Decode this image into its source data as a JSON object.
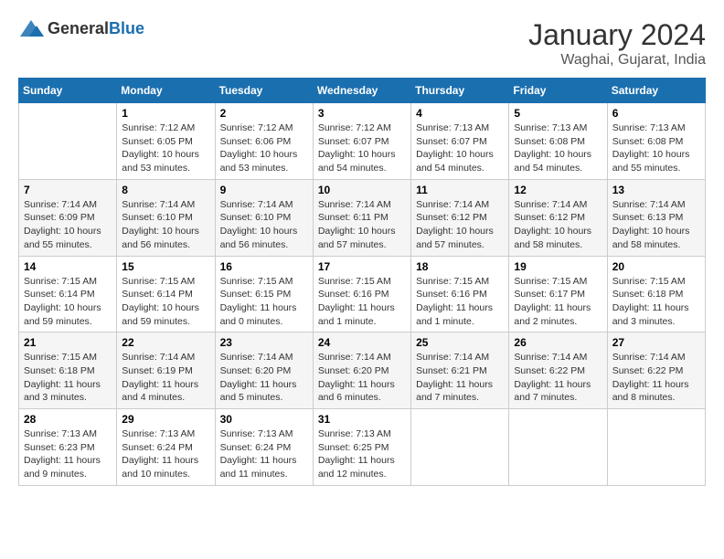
{
  "header": {
    "logo": {
      "general": "General",
      "blue": "Blue"
    },
    "title": "January 2024",
    "location": "Waghai, Gujarat, India"
  },
  "calendar": {
    "weekdays": [
      "Sunday",
      "Monday",
      "Tuesday",
      "Wednesday",
      "Thursday",
      "Friday",
      "Saturday"
    ],
    "weeks": [
      [
        {
          "day": "",
          "info": ""
        },
        {
          "day": "1",
          "info": "Sunrise: 7:12 AM\nSunset: 6:05 PM\nDaylight: 10 hours\nand 53 minutes."
        },
        {
          "day": "2",
          "info": "Sunrise: 7:12 AM\nSunset: 6:06 PM\nDaylight: 10 hours\nand 53 minutes."
        },
        {
          "day": "3",
          "info": "Sunrise: 7:12 AM\nSunset: 6:07 PM\nDaylight: 10 hours\nand 54 minutes."
        },
        {
          "day": "4",
          "info": "Sunrise: 7:13 AM\nSunset: 6:07 PM\nDaylight: 10 hours\nand 54 minutes."
        },
        {
          "day": "5",
          "info": "Sunrise: 7:13 AM\nSunset: 6:08 PM\nDaylight: 10 hours\nand 54 minutes."
        },
        {
          "day": "6",
          "info": "Sunrise: 7:13 AM\nSunset: 6:08 PM\nDaylight: 10 hours\nand 55 minutes."
        }
      ],
      [
        {
          "day": "7",
          "info": "Sunrise: 7:14 AM\nSunset: 6:09 PM\nDaylight: 10 hours\nand 55 minutes."
        },
        {
          "day": "8",
          "info": "Sunrise: 7:14 AM\nSunset: 6:10 PM\nDaylight: 10 hours\nand 56 minutes."
        },
        {
          "day": "9",
          "info": "Sunrise: 7:14 AM\nSunset: 6:10 PM\nDaylight: 10 hours\nand 56 minutes."
        },
        {
          "day": "10",
          "info": "Sunrise: 7:14 AM\nSunset: 6:11 PM\nDaylight: 10 hours\nand 57 minutes."
        },
        {
          "day": "11",
          "info": "Sunrise: 7:14 AM\nSunset: 6:12 PM\nDaylight: 10 hours\nand 57 minutes."
        },
        {
          "day": "12",
          "info": "Sunrise: 7:14 AM\nSunset: 6:12 PM\nDaylight: 10 hours\nand 58 minutes."
        },
        {
          "day": "13",
          "info": "Sunrise: 7:14 AM\nSunset: 6:13 PM\nDaylight: 10 hours\nand 58 minutes."
        }
      ],
      [
        {
          "day": "14",
          "info": "Sunrise: 7:15 AM\nSunset: 6:14 PM\nDaylight: 10 hours\nand 59 minutes."
        },
        {
          "day": "15",
          "info": "Sunrise: 7:15 AM\nSunset: 6:14 PM\nDaylight: 10 hours\nand 59 minutes."
        },
        {
          "day": "16",
          "info": "Sunrise: 7:15 AM\nSunset: 6:15 PM\nDaylight: 11 hours\nand 0 minutes."
        },
        {
          "day": "17",
          "info": "Sunrise: 7:15 AM\nSunset: 6:16 PM\nDaylight: 11 hours\nand 1 minute."
        },
        {
          "day": "18",
          "info": "Sunrise: 7:15 AM\nSunset: 6:16 PM\nDaylight: 11 hours\nand 1 minute."
        },
        {
          "day": "19",
          "info": "Sunrise: 7:15 AM\nSunset: 6:17 PM\nDaylight: 11 hours\nand 2 minutes."
        },
        {
          "day": "20",
          "info": "Sunrise: 7:15 AM\nSunset: 6:18 PM\nDaylight: 11 hours\nand 3 minutes."
        }
      ],
      [
        {
          "day": "21",
          "info": "Sunrise: 7:15 AM\nSunset: 6:18 PM\nDaylight: 11 hours\nand 3 minutes."
        },
        {
          "day": "22",
          "info": "Sunrise: 7:14 AM\nSunset: 6:19 PM\nDaylight: 11 hours\nand 4 minutes."
        },
        {
          "day": "23",
          "info": "Sunrise: 7:14 AM\nSunset: 6:20 PM\nDaylight: 11 hours\nand 5 minutes."
        },
        {
          "day": "24",
          "info": "Sunrise: 7:14 AM\nSunset: 6:20 PM\nDaylight: 11 hours\nand 6 minutes."
        },
        {
          "day": "25",
          "info": "Sunrise: 7:14 AM\nSunset: 6:21 PM\nDaylight: 11 hours\nand 7 minutes."
        },
        {
          "day": "26",
          "info": "Sunrise: 7:14 AM\nSunset: 6:22 PM\nDaylight: 11 hours\nand 7 minutes."
        },
        {
          "day": "27",
          "info": "Sunrise: 7:14 AM\nSunset: 6:22 PM\nDaylight: 11 hours\nand 8 minutes."
        }
      ],
      [
        {
          "day": "28",
          "info": "Sunrise: 7:13 AM\nSunset: 6:23 PM\nDaylight: 11 hours\nand 9 minutes."
        },
        {
          "day": "29",
          "info": "Sunrise: 7:13 AM\nSunset: 6:24 PM\nDaylight: 11 hours\nand 10 minutes."
        },
        {
          "day": "30",
          "info": "Sunrise: 7:13 AM\nSunset: 6:24 PM\nDaylight: 11 hours\nand 11 minutes."
        },
        {
          "day": "31",
          "info": "Sunrise: 7:13 AM\nSunset: 6:25 PM\nDaylight: 11 hours\nand 12 minutes."
        },
        {
          "day": "",
          "info": ""
        },
        {
          "day": "",
          "info": ""
        },
        {
          "day": "",
          "info": ""
        }
      ]
    ]
  }
}
